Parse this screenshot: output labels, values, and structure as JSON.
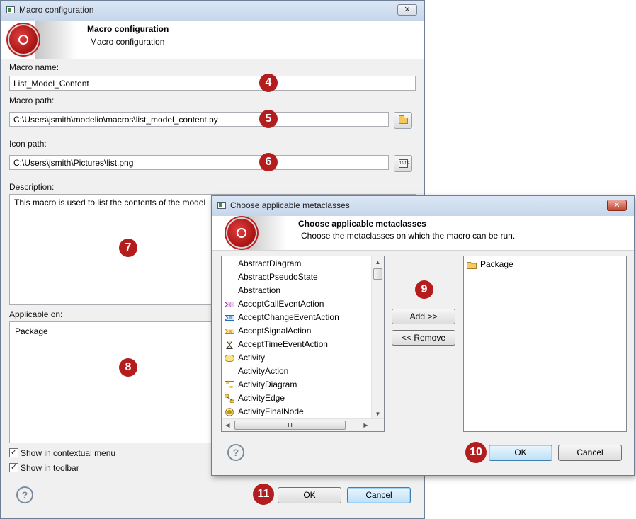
{
  "main_dialog": {
    "title": "Macro configuration",
    "header_title": "Macro configuration",
    "header_subtitle": "Macro configuration",
    "macro_name_label": "Macro name:",
    "macro_name_value": "List_Model_Content",
    "macro_path_label": "Macro path:",
    "macro_path_value": "C:\\Users\\jsmith\\modelio\\macros\\list_model_content.py",
    "icon_path_label": "Icon path:",
    "icon_path_value": "C:\\Users\\jsmith\\Pictures\\list.png",
    "description_label": "Description:",
    "description_value": "This macro is used to list the contents of the model",
    "applicable_on_label": "Applicable on:",
    "applicable_on_items": [
      "Package"
    ],
    "show_contextual_label": "Show in contextual menu",
    "show_contextual_checked": true,
    "show_toolbar_label": "Show in toolbar",
    "show_toolbar_checked": true,
    "ok_label": "OK",
    "cancel_label": "Cancel",
    "close_label": "✕"
  },
  "metaclass_dialog": {
    "title": "Choose applicable metaclasses",
    "header_title": "Choose applicable metaclasses",
    "header_subtitle": "Choose the metaclasses on which the macro can be run.",
    "available": [
      {
        "label": "AbstractDiagram",
        "icon": "none"
      },
      {
        "label": "AbstractPseudoState",
        "icon": "none"
      },
      {
        "label": "Abstraction",
        "icon": "none"
      },
      {
        "label": "AcceptCallEventAction",
        "icon": "accept-call-event-icon"
      },
      {
        "label": "AcceptChangeEventAction",
        "icon": "accept-change-event-icon"
      },
      {
        "label": "AcceptSignalAction",
        "icon": "accept-signal-icon"
      },
      {
        "label": "AcceptTimeEventAction",
        "icon": "hourglass-icon"
      },
      {
        "label": "Activity",
        "icon": "activity-icon"
      },
      {
        "label": "ActivityAction",
        "icon": "none"
      },
      {
        "label": "ActivityDiagram",
        "icon": "activity-diagram-icon"
      },
      {
        "label": "ActivityEdge",
        "icon": "activity-edge-icon"
      },
      {
        "label": "ActivityFinalNode",
        "icon": "final-node-icon"
      }
    ],
    "selected": [
      {
        "label": "Package",
        "icon": "folder-icon"
      }
    ],
    "add_label": "Add >>",
    "remove_label": "<< Remove",
    "ok_label": "OK",
    "cancel_label": "Cancel",
    "close_label": "✕",
    "hscroll_grip": "III"
  },
  "callouts": [
    "4",
    "5",
    "6",
    "7",
    "8",
    "9",
    "10",
    "11"
  ],
  "help_glyph": "?",
  "check_glyph": "✓",
  "scroll_up_glyph": "▲",
  "scroll_down_glyph": "▼",
  "scroll_left_glyph": "◀",
  "scroll_right_glyph": "▶",
  "colors": {
    "callout": "#b41d1d",
    "default_button": "#bfe0f7"
  }
}
